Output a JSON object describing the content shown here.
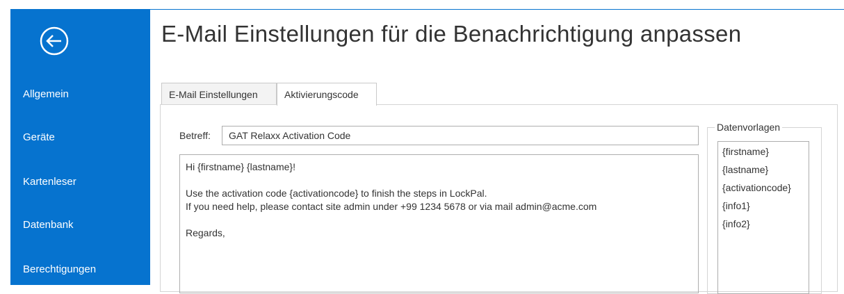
{
  "page": {
    "title": "E-Mail Einstellungen für die Benachrichtigung anpassen"
  },
  "sidebar": {
    "items": [
      {
        "label": "Allgemein"
      },
      {
        "label": "Geräte"
      },
      {
        "label": "Kartenleser"
      },
      {
        "label": "Datenbank"
      },
      {
        "label": "Berechtigungen"
      }
    ]
  },
  "tabs": [
    {
      "label": "E-Mail Einstellungen",
      "active": false
    },
    {
      "label": "Aktivierungscode",
      "active": true
    }
  ],
  "form": {
    "subject_label": "Betreff:",
    "subject_value": "GAT Relaxx Activation Code",
    "body_lines": [
      "Hi {firstname} {lastname}!",
      "",
      "Use the activation code {activationcode} to finish the steps in LockPal.",
      "If you need help, please contact site admin under +99 1234 5678 or via mail admin@acme.com",
      "",
      "Regards,"
    ]
  },
  "templates": {
    "title": "Datenvorlagen",
    "items": [
      "{firstname}",
      "{lastname}",
      "{activationcode}",
      "{info1}",
      "{info2}"
    ]
  },
  "colors": {
    "accent": "#0673cf",
    "text": "#333333"
  }
}
